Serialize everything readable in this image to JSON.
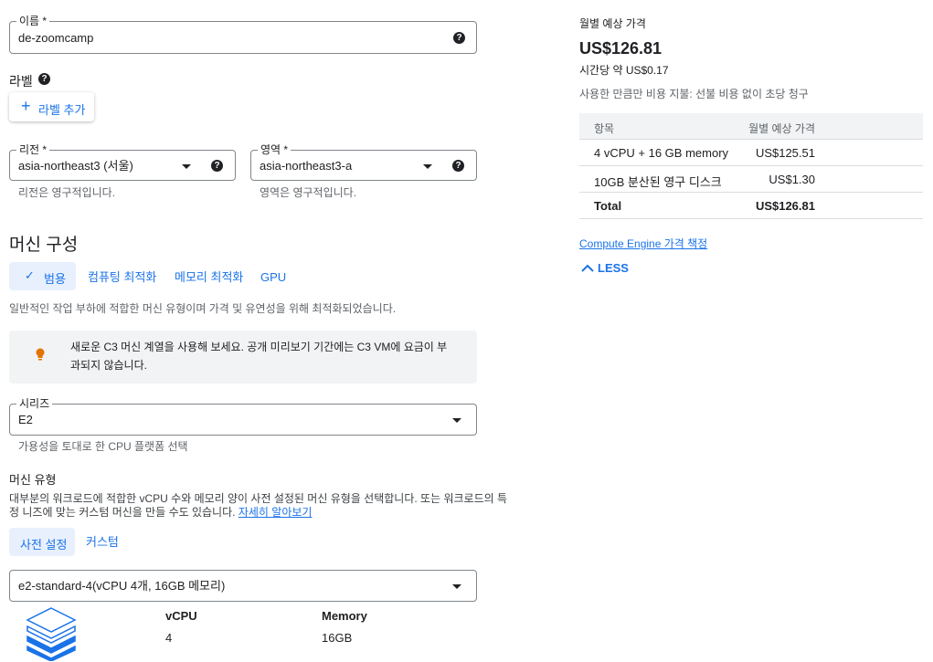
{
  "name_field": {
    "label": "이름 *",
    "value": "de-zoomcamp"
  },
  "labels": {
    "title": "라벨",
    "add_button": "라벨 추가"
  },
  "region": {
    "label": "리전 *",
    "value": "asia-northeast3 (서울)",
    "hint": "리전은 영구적입니다."
  },
  "zone": {
    "label": "영역 *",
    "value": "asia-northeast3-a",
    "hint": "영역은 영구적입니다."
  },
  "machine_config": {
    "title": "머신 구성",
    "tabs": [
      "범용",
      "컴퓨팅 최적화",
      "메모리 최적화",
      "GPU"
    ],
    "description": "일반적인 작업 부하에 적합한 머신 유형이며 가격 및 유연성을 위해 최적화되었습니다.",
    "notice_line1": "새로운 C3 머신 계열을 사용해 보세요. 공개 미리보기 기간에는 C3 VM에 요금이 부",
    "notice_line2": "과되지 않습니다."
  },
  "series": {
    "label": "시리즈",
    "value": "E2",
    "hint": "가용성을 토대로 한 CPU 플랫폼 선택"
  },
  "machine_type": {
    "title": "머신 유형",
    "desc_line1": "대부분의 워크로드에 적합한 vCPU 수와 메모리 양이 사전 설정된 머신 유형을 선택합니다. 또는 워크로드의 특",
    "desc_line2": "정 니즈에 맞는 커스텀 머신을 만들 수도 있습니다.",
    "learn_more": "자세히 알아보기",
    "tabs": [
      "사전 설정",
      "커스텀"
    ],
    "selected": "e2-standard-4(vCPU 4개, 16GB 메모리)",
    "vcpu_label": "vCPU",
    "vcpu_value": "4",
    "memory_label": "Memory",
    "memory_value": "16GB"
  },
  "pricing": {
    "title": "월별 예상 가격",
    "monthly": "US$126.81",
    "hourly": "시간당 약 US$0.17",
    "note": "사용한 만큼만 비용 지불: 선불 비용 없이 초당 청구",
    "table_headers": [
      "항목",
      "월별 예상 가격"
    ],
    "rows": [
      {
        "item": "4 vCPU + 16 GB memory",
        "price": "US$125.51"
      },
      {
        "item": "10GB 분산된 영구 디스크",
        "price": "US$1.30"
      },
      {
        "item": "Total",
        "price": "US$126.81"
      }
    ],
    "link": "Compute Engine 가격 책정",
    "less": "LESS"
  },
  "colors": {
    "accent": "#1a73e8",
    "notice_bg": "#f1f3f4",
    "bulb": "#e37400"
  }
}
